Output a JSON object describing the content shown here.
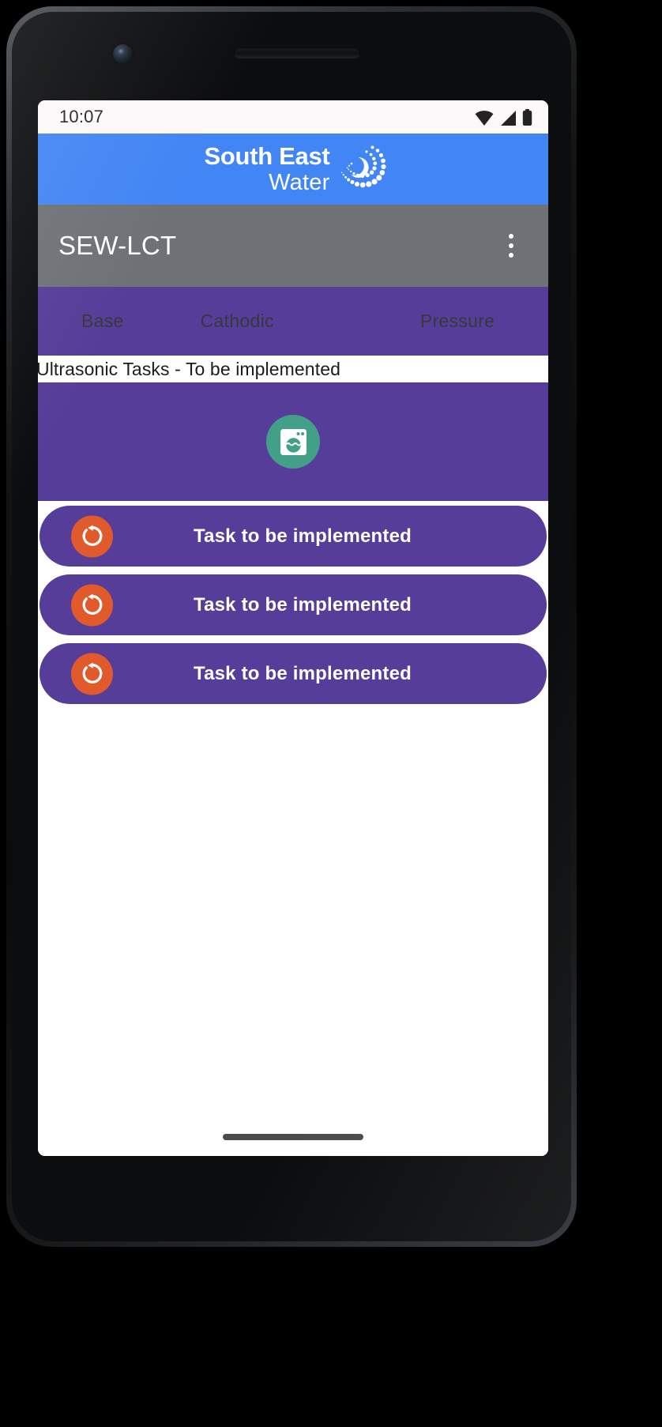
{
  "device": {
    "frame_color": "#0a0b0c",
    "screen_background": "#ffffff"
  },
  "status_bar": {
    "time": "10:07",
    "icons": [
      "wifi-icon",
      "cellular-signal-icon",
      "battery-icon"
    ]
  },
  "brand_banner": {
    "background_color": "#4285f4",
    "line1": "South East",
    "line2": "Water",
    "logo_icon": "south-east-water-swirl-logo"
  },
  "app_bar": {
    "background_color": "#6e7276",
    "title": "SEW-LCT",
    "overflow_icon": "more-vertical-icon"
  },
  "tab_bar": {
    "background_color": "#563d99",
    "text_color": "#38383a",
    "tabs": [
      {
        "label": "Base",
        "selected": false
      },
      {
        "label": "Cathodic",
        "selected": false
      },
      {
        "label": "Pressure",
        "selected": false
      }
    ]
  },
  "section_header": {
    "text": "Ultrasonic Tasks - To be implemented",
    "background_color": "#ffffff",
    "text_color": "#1b1b1b"
  },
  "hero_panel": {
    "background_color": "#563d99",
    "icon_name": "ultrasonic-meter-icon",
    "icon_background_color": "#43a088",
    "icon_glyph_color": "#ffffff"
  },
  "task_list": {
    "row_background_color": "#563d99",
    "status_icon_color": "#e05a2b",
    "status_icon_name": "refresh-pending-icon",
    "rows": [
      {
        "label": "Task to be implemented",
        "status": "pending"
      },
      {
        "label": "Task to be implemented",
        "status": "pending"
      },
      {
        "label": "Task to be implemented",
        "status": "pending"
      }
    ]
  },
  "navigation": {
    "gesture_pill": "home-gesture-pill",
    "pill_color": "#4b4b4b"
  }
}
